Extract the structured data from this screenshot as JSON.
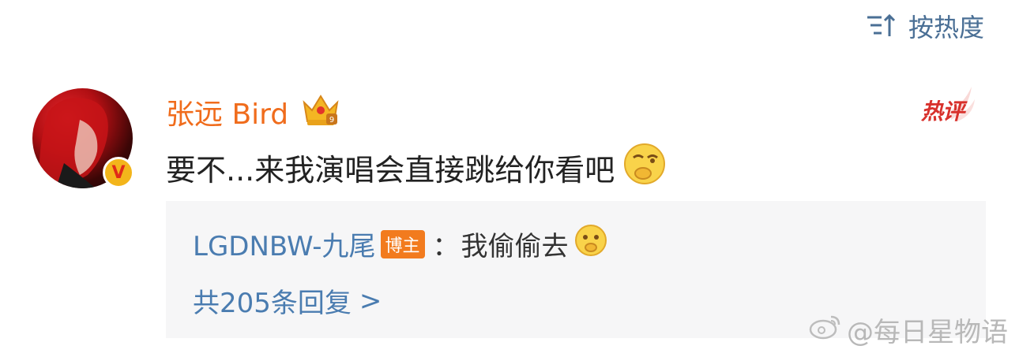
{
  "sort": {
    "label": "按热度",
    "icon": "sort-icon"
  },
  "comment": {
    "username": "张远 Bird",
    "hot_label": "热评",
    "verified_badge": "V",
    "text": "要不...来我演唱会直接跳给你看吧"
  },
  "reply": {
    "user": "LGDNBW-九尾",
    "badge": "博主",
    "separator": "：",
    "text": "我偷偷去",
    "more_label": "共205条回复",
    "more_chevron": ">"
  },
  "watermark": {
    "text": "@每日星物语"
  },
  "colors": {
    "username": "#f06c1c",
    "link": "#4a7cb0",
    "hot": "#d8312c",
    "badge": "#f27b1e",
    "reply_bg": "#f6f6f7"
  }
}
